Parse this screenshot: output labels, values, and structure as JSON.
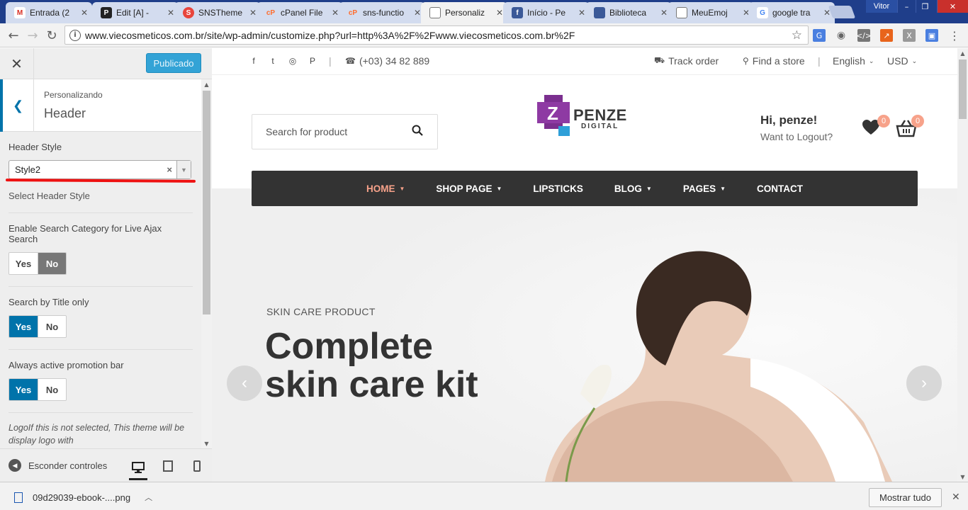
{
  "browser": {
    "tabs": [
      {
        "label": "Entrada (2",
        "icon": "gmail-icon",
        "color": "#d93025",
        "glyph": "M",
        "active": false
      },
      {
        "label": "Edit [A] - ",
        "icon": "pinterest-icon",
        "color": "#222222",
        "glyph": "P",
        "active": false
      },
      {
        "label": "SNSTheme",
        "icon": "snstheme-icon",
        "color": "#e8453c",
        "glyph": "S",
        "active": false
      },
      {
        "label": "cPanel File",
        "icon": "cpanel-icon",
        "color": "#ff6c2c",
        "glyph": "cP",
        "active": false
      },
      {
        "label": "sns-functio",
        "icon": "cpanel-icon",
        "color": "#ff6c2c",
        "glyph": "cP",
        "active": false
      },
      {
        "label": "Personaliz",
        "icon": "page-icon",
        "color": "#777777",
        "glyph": "",
        "active": true
      },
      {
        "label": "Início - Pe",
        "icon": "facebook-icon",
        "color": "#3b5998",
        "glyph": "",
        "active": false
      },
      {
        "label": "Biblioteca",
        "icon": "library-icon",
        "color": "#3b5998",
        "glyph": "",
        "active": false
      },
      {
        "label": "MeuEmoj",
        "icon": "page-icon",
        "color": "#777777",
        "glyph": "",
        "active": false
      },
      {
        "label": "google tra",
        "icon": "google-icon",
        "color": "#4285f4",
        "glyph": "G",
        "active": false
      }
    ],
    "profile": "Vitor",
    "url": "www.viecosmeticos.com.br/site/wp-admin/customize.php?url=http%3A%2F%2Fwww.viecosmeticos.com.br%2F"
  },
  "customizer": {
    "publish_label": "Publicado",
    "crumb": "Personalizando",
    "title": "Header",
    "header_style": {
      "label": "Header Style",
      "value": "Style2",
      "description": "Select Header Style"
    },
    "search_category": {
      "label": "Enable Search Category for Live Ajax Search",
      "yes": "Yes",
      "no": "No",
      "selected": "no"
    },
    "search_title": {
      "label": "Search by Title only",
      "yes": "Yes",
      "no": "No",
      "selected": "yes"
    },
    "promotion_bar": {
      "label": "Always active promotion bar",
      "yes": "Yes",
      "no": "No",
      "selected": "yes"
    },
    "logo_note": "LogoIf this is not selected, This theme will be display logo with \"theme/snsvicky/img/logo.png\"",
    "hide_controls": "Esconder controles"
  },
  "site": {
    "phone": "(+03) 34 82 889",
    "track_order": "Track order",
    "find_store": "Find a store",
    "language": "English",
    "currency": "USD",
    "search_placeholder": "Search for product",
    "logo_word": "PENZE",
    "logo_sub": "DIGITAL",
    "greeting": "Hi, penze!",
    "logout": "Want to Logout?",
    "wishlist_count": "0",
    "cart_count": "0",
    "nav": [
      "HOME",
      "SHOP PAGE",
      "LIPSTICKS",
      "BLOG",
      "PAGES",
      "CONTACT"
    ],
    "hero_kicker": "SKIN CARE PRODUCT",
    "hero_line1": "Complete",
    "hero_line2": "skin care kit",
    "accent": "#f7a28a"
  },
  "downloads": {
    "file": "09d29039-ebook-....png",
    "show_all": "Mostrar tudo"
  }
}
